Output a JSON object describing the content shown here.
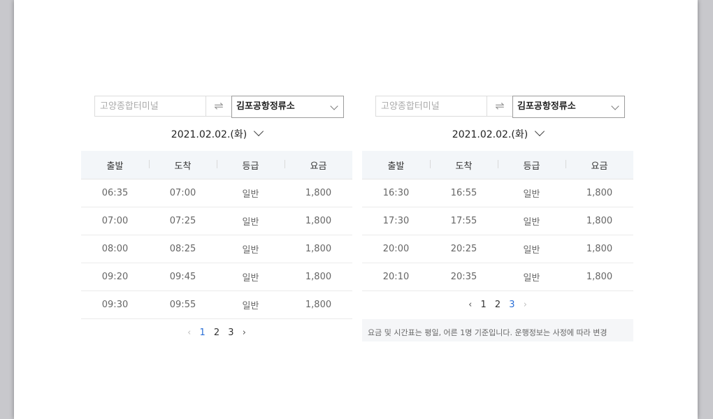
{
  "left": {
    "route": {
      "from_placeholder": "고양종합터미널",
      "swap_icon": "⇌",
      "to_value": "김포공항정류소"
    },
    "date": "2021.02.02.(화)",
    "columns": [
      "출발",
      "도착",
      "등급",
      "요금"
    ],
    "rows": [
      [
        "06:35",
        "07:00",
        "일반",
        "1,800"
      ],
      [
        "07:00",
        "07:25",
        "일반",
        "1,800"
      ],
      [
        "08:00",
        "08:25",
        "일반",
        "1,800"
      ],
      [
        "09:20",
        "09:45",
        "일반",
        "1,800"
      ],
      [
        "09:30",
        "09:55",
        "일반",
        "1,800"
      ]
    ],
    "pager": {
      "prev": "‹",
      "pages": [
        "1",
        "2",
        "3"
      ],
      "current": "1",
      "next": "›"
    }
  },
  "right": {
    "route": {
      "from_placeholder": "고양종합터미널",
      "swap_icon": "⇌",
      "to_value": "김포공항정류소"
    },
    "date": "2021.02.02.(화)",
    "columns": [
      "출발",
      "도착",
      "등급",
      "요금"
    ],
    "rows": [
      [
        "16:30",
        "16:55",
        "일반",
        "1,800"
      ],
      [
        "17:30",
        "17:55",
        "일반",
        "1,800"
      ],
      [
        "20:00",
        "20:25",
        "일반",
        "1,800"
      ],
      [
        "20:10",
        "20:35",
        "일반",
        "1,800"
      ]
    ],
    "pager": {
      "prev": "‹",
      "pages": [
        "1",
        "2",
        "3"
      ],
      "current": "3",
      "next": "›"
    },
    "notice": "요금 및 시간표는 평일, 어른 1명 기준입니다. 운행정보는 사정에 따라 변경"
  },
  "colors": {
    "accent": "#2a6fd6",
    "header_bg": "#f3f6f9",
    "notice_bg": "#f5f6f8"
  }
}
